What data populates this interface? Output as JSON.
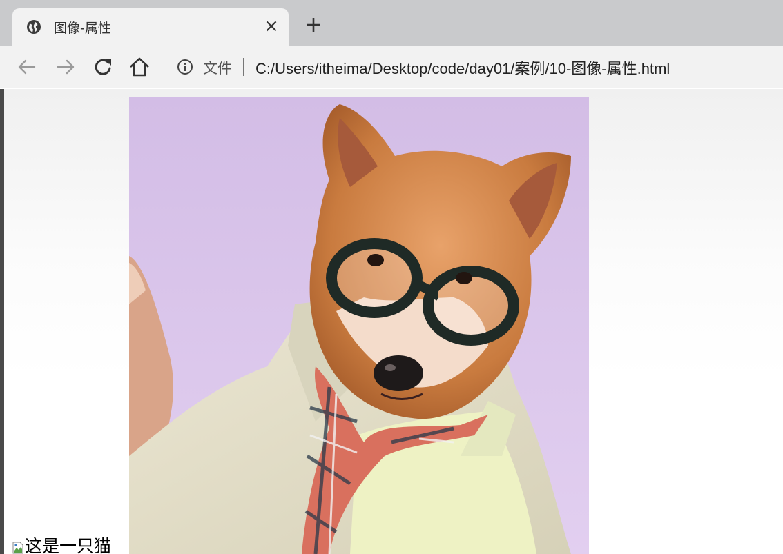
{
  "browser": {
    "tab": {
      "title": "图像-属性",
      "close_glyph": "×",
      "favicon": "globe-icon"
    },
    "new_tab_icon": "plus-icon",
    "nav": {
      "back_icon": "arrow-left-icon",
      "forward_icon": "arrow-right-icon",
      "reload_icon": "reload-icon",
      "home_icon": "home-icon"
    },
    "omnibox": {
      "security_icon": "info-icon",
      "security_label": "文件",
      "url": "C:/Users/itheima/Desktop/code/day01/案例/10-图像-属性.html"
    }
  },
  "page": {
    "photo_description_icon": "dog-photo",
    "broken_image": {
      "icon": "broken-image-icon",
      "alt_text": "这是一只猫"
    }
  },
  "colors": {
    "tab_strip": "#c9cacc",
    "toolbar": "#f2f2f2",
    "photo_background": "#dcc6ea"
  }
}
